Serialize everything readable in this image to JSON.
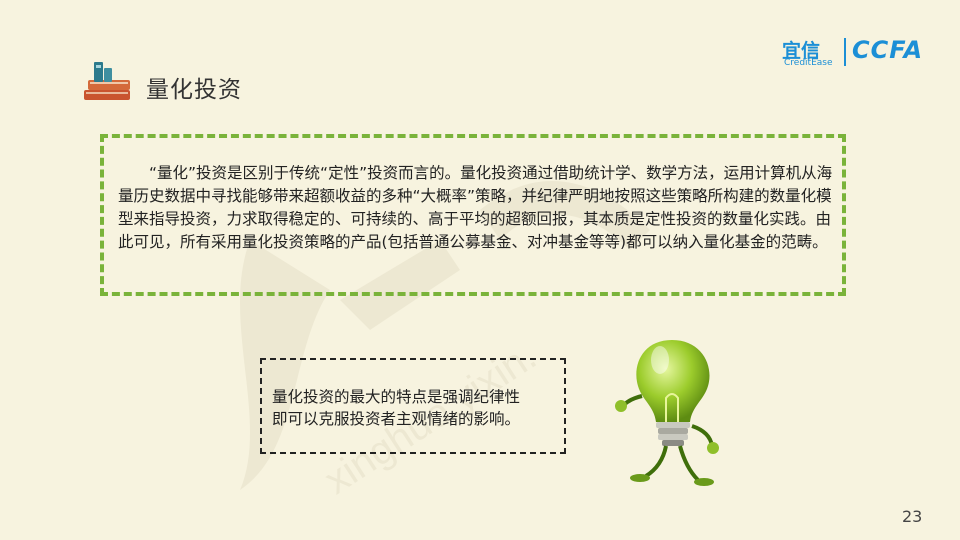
{
  "header": {
    "title": "量化投资",
    "logo": {
      "cn": "宜信",
      "en": "CreditEase",
      "ccfa": "CCFA"
    }
  },
  "main": {
    "paragraph": "“量化”投资是区别于传统“定性”投资而言的。量化投资通过借助统计学、数学方法，运用计算机从海量历史数据中寻找能够带来超额收益的多种“大概率”策略，并纪律严明地按照这些策略所构建的数量化模型来指导投资，力求取得稳定的、可持续的、高于平均的超额回报，其本质是定性投资的数量化实践。由此可见，所有采用量化投资策略的产品(包括普通公募基金、对冲基金等等)都可以纳入量化基金的范畴。"
  },
  "callout": {
    "line1": "量化投资的最大的特点是强调纪律性",
    "line2": "即可以克服投资者主观情绪的影响。"
  },
  "watermark": {
    "text": "xinghuo.yixin."
  },
  "footer": {
    "page_number": "23"
  },
  "colors": {
    "background": "#f7f3df",
    "accent_green": "#7ab33a",
    "logo_blue": "#1c8fd6"
  },
  "icons": {
    "title_icon": "books-icon",
    "illustration": "lightbulb-mascot-icon"
  }
}
